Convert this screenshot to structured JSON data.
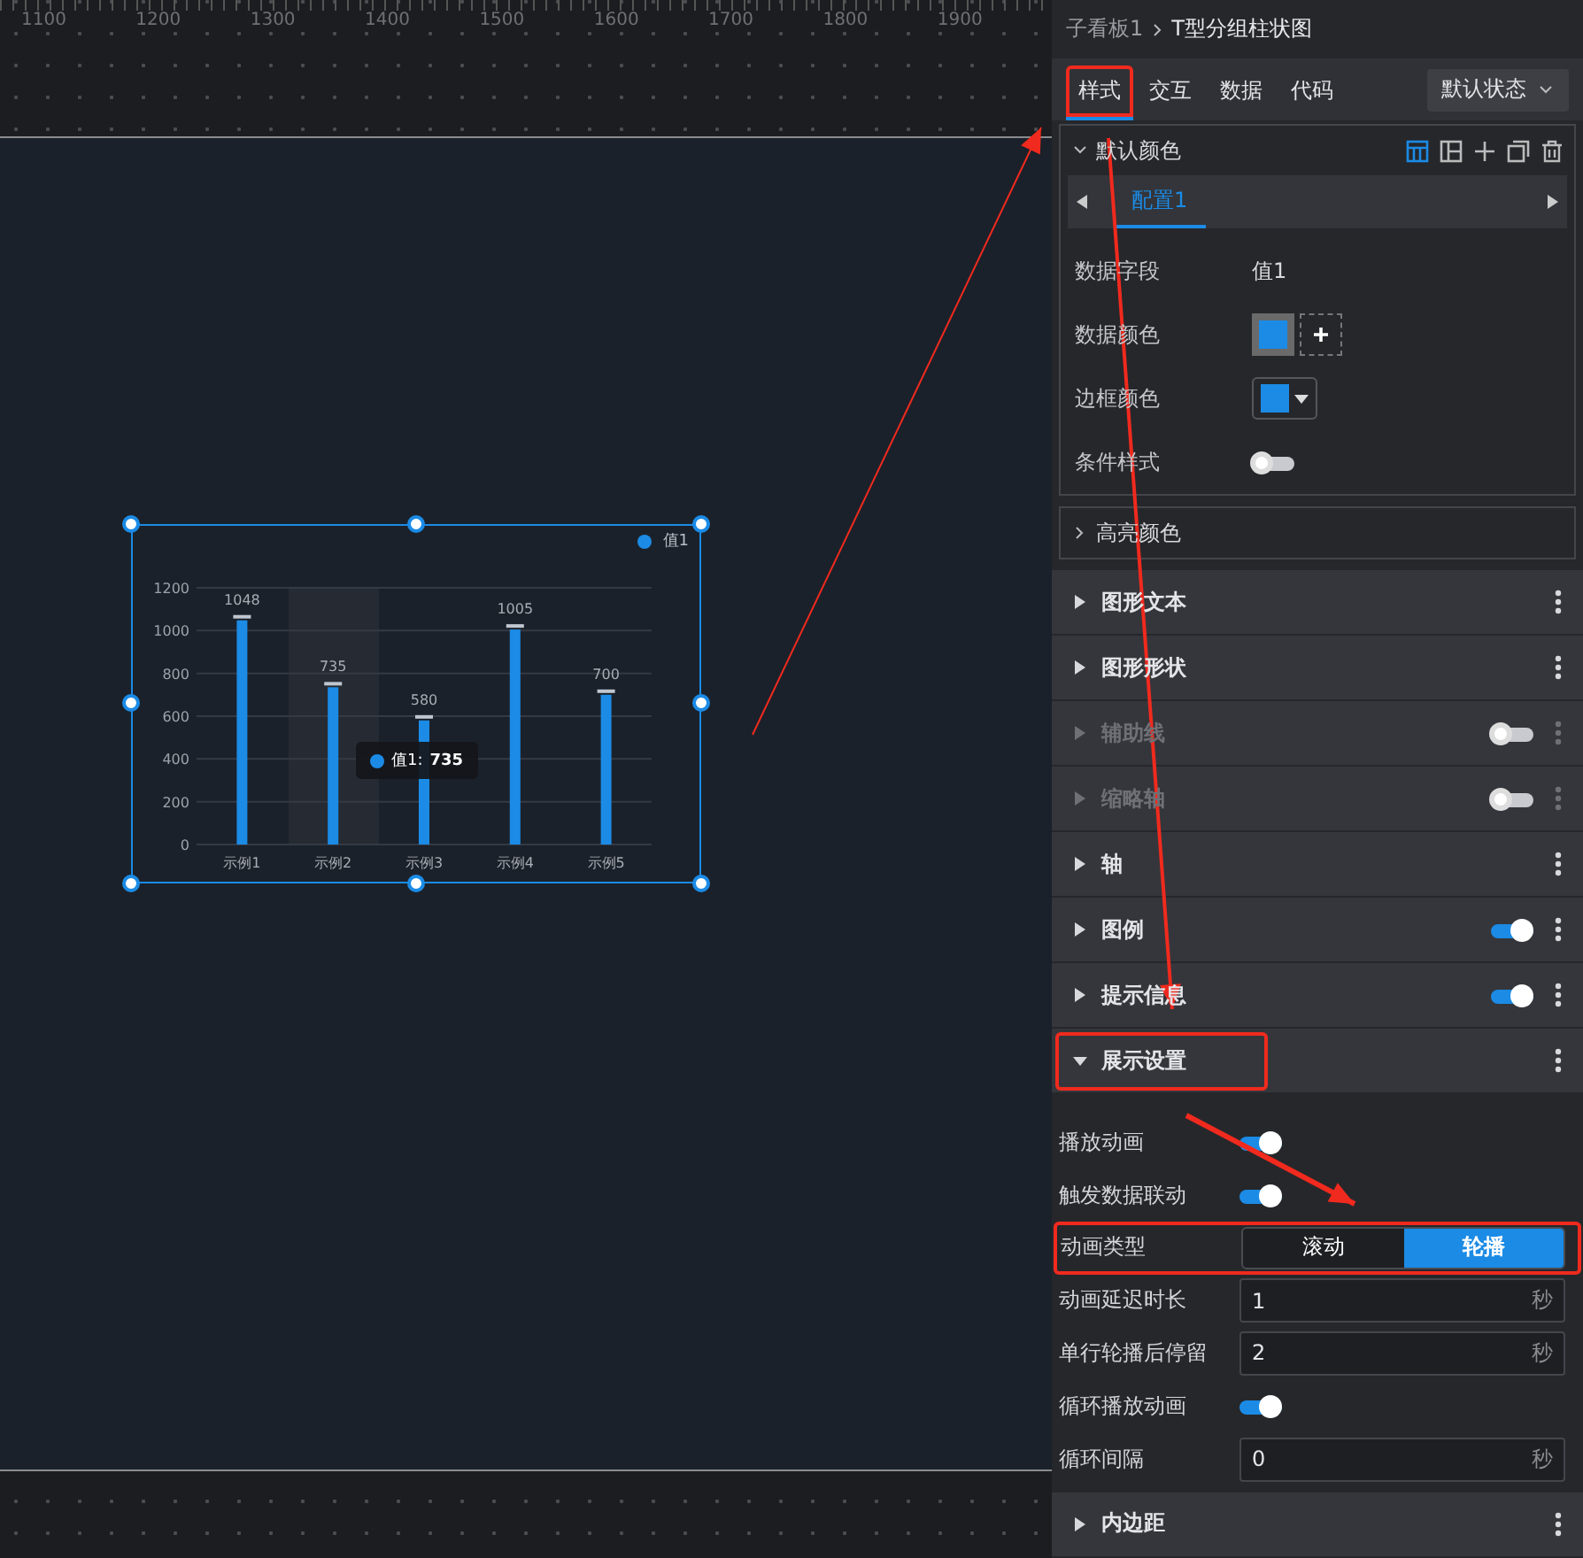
{
  "ruler": {
    "labels": [
      "1100",
      "1200",
      "1300",
      "1400",
      "1500",
      "1600",
      "1700",
      "1800",
      "1900"
    ]
  },
  "chart": {
    "tooltip": {
      "label": "值1:",
      "value": "735"
    },
    "chart_data": {
      "type": "bar",
      "categories": [
        "示例1",
        "示例2",
        "示例3",
        "示例4",
        "示例5"
      ],
      "series": [
        {
          "name": "值1",
          "color": "#1b8be6",
          "values": [
            1048,
            735,
            580,
            1005,
            700
          ]
        }
      ],
      "ylim": [
        0,
        1200
      ],
      "yticks": [
        0,
        200,
        400,
        600,
        800,
        1000,
        1200
      ],
      "grid": true,
      "data_labels": true
    }
  },
  "panel": {
    "breadcrumb": {
      "parent": "子看板1",
      "current": "T型分组柱状图"
    },
    "tabs": [
      {
        "label": "样式",
        "selected": true,
        "highlighted": true
      },
      {
        "label": "交互",
        "selected": false,
        "highlighted": false
      },
      {
        "label": "数据",
        "selected": false,
        "highlighted": false
      },
      {
        "label": "代码",
        "selected": false,
        "highlighted": false
      }
    ],
    "state_select": "默认状态",
    "color_group": {
      "title": "默认颜色",
      "expanded": true,
      "config_tabs": [
        {
          "label": "配置1",
          "selected": true
        }
      ],
      "field_label": "数据字段",
      "field_value": "值1",
      "data_color_label": "数据颜色",
      "border_color_label": "边框颜色",
      "condition_label": "条件样式",
      "condition_on": false
    },
    "highlight_group": {
      "title": "高亮颜色",
      "expanded": false
    },
    "sections": [
      {
        "title": "图形文本",
        "expanded": false,
        "disabled": false,
        "highlighted": false
      },
      {
        "title": "图形形状",
        "expanded": false,
        "disabled": false,
        "highlighted": false
      },
      {
        "title": "辅助线",
        "expanded": false,
        "disabled": true,
        "toggle": false,
        "highlighted": false
      },
      {
        "title": "缩略轴",
        "expanded": false,
        "disabled": true,
        "toggle": false,
        "highlighted": false
      },
      {
        "title": "轴",
        "expanded": false,
        "disabled": false,
        "highlighted": false
      },
      {
        "title": "图例",
        "expanded": false,
        "disabled": false,
        "toggle": true,
        "highlighted": false
      },
      {
        "title": "提示信息",
        "expanded": false,
        "disabled": false,
        "toggle": true,
        "highlighted": false
      },
      {
        "title": "展示设置",
        "expanded": true,
        "disabled": false,
        "highlighted": true
      }
    ],
    "settings": [
      {
        "kind": "toggle",
        "label": "播放动画",
        "on": true,
        "highlighted": false
      },
      {
        "kind": "toggle",
        "label": "触发数据联动",
        "on": true,
        "highlighted": false
      },
      {
        "kind": "segmented",
        "label": "动画类型",
        "options": [
          {
            "label": "滚动",
            "selected": false
          },
          {
            "label": "轮播",
            "selected": true
          }
        ],
        "highlighted": true
      },
      {
        "kind": "number",
        "label": "动画延迟时长",
        "value": "1",
        "unit": "秒",
        "highlighted": false
      },
      {
        "kind": "number",
        "label": "单行轮播后停留",
        "value": "2",
        "unit": "秒",
        "highlighted": false
      },
      {
        "kind": "toggle",
        "label": "循环播放动画",
        "on": true,
        "highlighted": false
      },
      {
        "kind": "number",
        "label": "循环间隔",
        "value": "0",
        "unit": "秒",
        "highlighted": false
      }
    ],
    "next_section": {
      "title": "内边距",
      "expanded": false
    }
  }
}
